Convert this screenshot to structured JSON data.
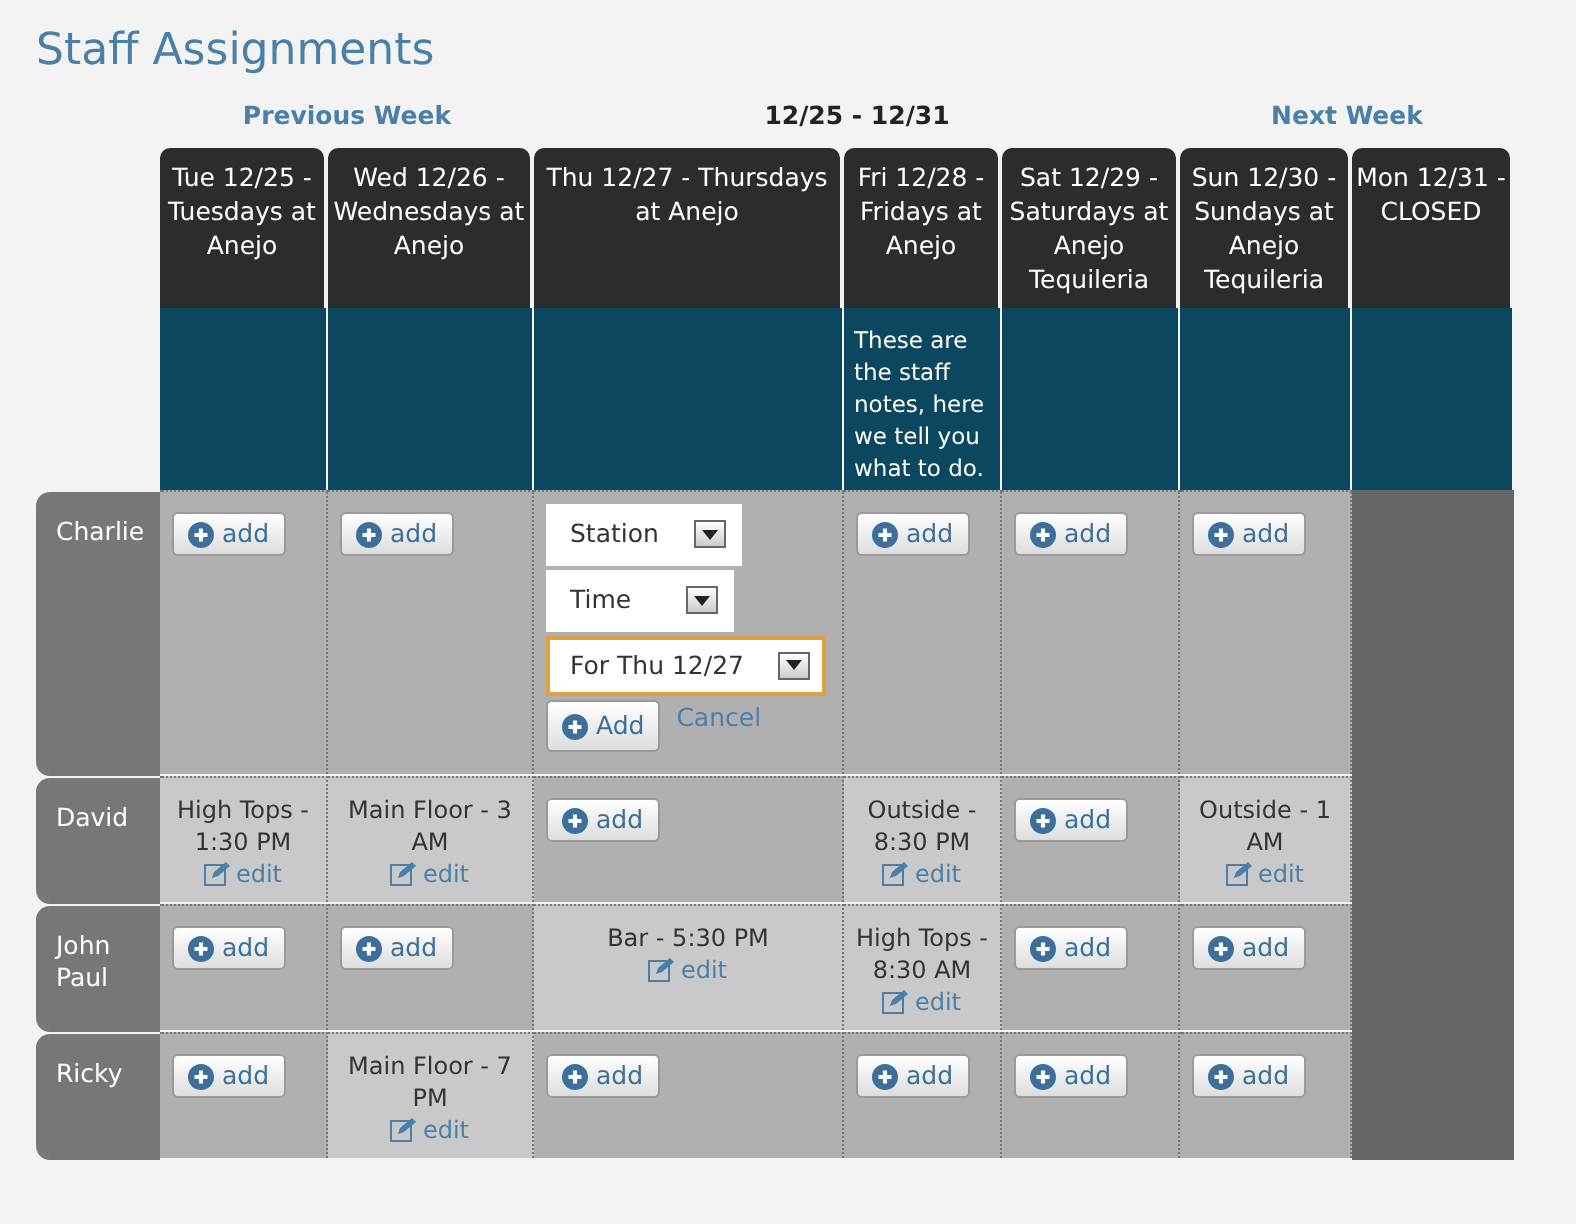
{
  "title": "Staff Assignments",
  "nav": {
    "previous": "Previous Week",
    "range": "12/25 - 12/31",
    "next": "Next Week"
  },
  "days": [
    {
      "label": "Tue 12/25 - Tuesdays at Anejo",
      "closed": false
    },
    {
      "label": "Wed 12/26 - Wednesdays at Anejo",
      "closed": false
    },
    {
      "label": "Thu 12/27 - Thursdays at Anejo",
      "closed": false
    },
    {
      "label": "Fri 12/28 - Fridays at Anejo",
      "notes": "These are the staff notes, here we tell you what to do.",
      "closed": false
    },
    {
      "label": "Sat 12/29 - Saturdays at Anejo Tequileria",
      "closed": false
    },
    {
      "label": "Sun 12/30 - Sundays at Anejo Tequileria",
      "closed": false
    },
    {
      "label": "Mon 12/31 - CLOSED",
      "closed": true
    }
  ],
  "staff": [
    {
      "name": "Charlie",
      "cells": [
        {
          "kind": "add",
          "button": "add"
        },
        {
          "kind": "add",
          "button": "add"
        },
        {
          "kind": "form",
          "selects": [
            {
              "value": "Station",
              "focused": false
            },
            {
              "value": "Time",
              "focused": false
            },
            {
              "value": "For Thu 12/27",
              "focused": true
            }
          ],
          "button": "Add",
          "cancel": "Cancel"
        },
        {
          "kind": "add",
          "button": "add"
        },
        {
          "kind": "add",
          "button": "add"
        },
        {
          "kind": "add",
          "button": "add"
        }
      ]
    },
    {
      "name": "David",
      "cells": [
        {
          "kind": "shift",
          "text": "High Tops - 1:30 PM",
          "link": "edit"
        },
        {
          "kind": "shift",
          "text": "Main Floor - 3 AM",
          "link": "edit"
        },
        {
          "kind": "add",
          "button": "add"
        },
        {
          "kind": "shift",
          "text": "Outside - 8:30 PM",
          "link": "edit"
        },
        {
          "kind": "add",
          "button": "add"
        },
        {
          "kind": "shift",
          "text": "Outside - 1 AM",
          "link": "edit"
        }
      ]
    },
    {
      "name": "John Paul",
      "cells": [
        {
          "kind": "add",
          "button": "add"
        },
        {
          "kind": "add",
          "button": "add"
        },
        {
          "kind": "shift",
          "text": "Bar - 5:30 PM",
          "link": "edit"
        },
        {
          "kind": "shift",
          "text": "High Tops - 8:30 AM",
          "link": "edit"
        },
        {
          "kind": "add",
          "button": "add"
        },
        {
          "kind": "add",
          "button": "add"
        }
      ]
    },
    {
      "name": "Ricky",
      "cells": [
        {
          "kind": "add",
          "button": "add"
        },
        {
          "kind": "shift",
          "text": "Main Floor - 7 PM",
          "link": "edit"
        },
        {
          "kind": "add",
          "button": "add"
        },
        {
          "kind": "add",
          "button": "add"
        },
        {
          "kind": "add",
          "button": "add"
        },
        {
          "kind": "add",
          "button": "add"
        }
      ]
    }
  ]
}
